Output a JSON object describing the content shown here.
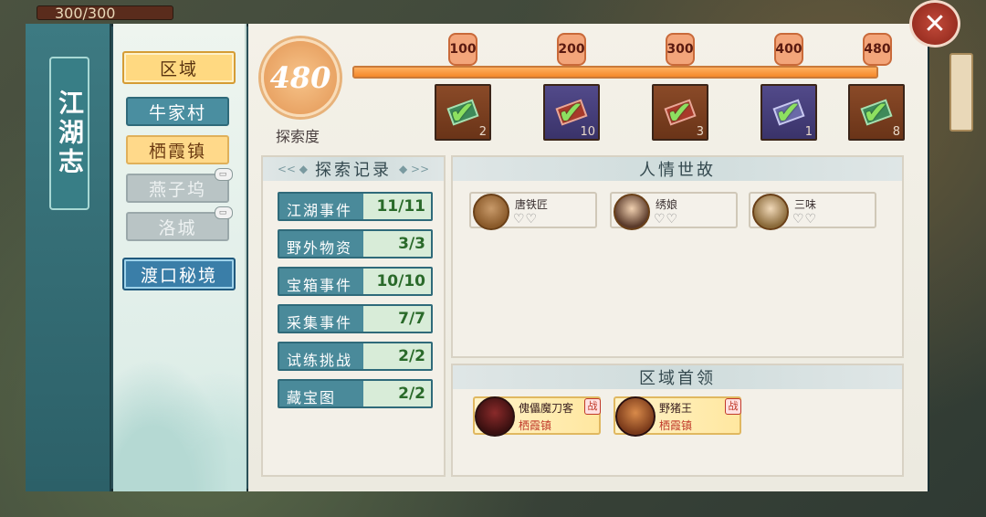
{
  "hud": {
    "hp": "300/300"
  },
  "sidebar_title": "江湖志",
  "nav": {
    "header": "区域",
    "items": [
      {
        "label": "牛家村"
      },
      {
        "label": "栖霞镇"
      },
      {
        "label": "燕子坞"
      },
      {
        "label": "洛城"
      }
    ],
    "secret": "渡口秘境"
  },
  "exploration": {
    "score": "480",
    "label": "探索度",
    "progress": 1.0,
    "milestones": [
      "100",
      "200",
      "300",
      "400",
      "480"
    ],
    "rewards": [
      {
        "count": "2",
        "tier": "brown"
      },
      {
        "count": "10",
        "tier": "purple"
      },
      {
        "count": "3",
        "tier": "brown"
      },
      {
        "count": "1",
        "tier": "purple"
      },
      {
        "count": "8",
        "tier": "brown"
      }
    ]
  },
  "records": {
    "title": "探索记录",
    "items": [
      {
        "label": "江湖事件",
        "value": "11/11"
      },
      {
        "label": "野外物资",
        "value": "3/3"
      },
      {
        "label": "宝箱事件",
        "value": "10/10"
      },
      {
        "label": "采集事件",
        "value": "7/7"
      },
      {
        "label": "试练挑战",
        "value": "2/2"
      },
      {
        "label": "藏宝图",
        "value": "2/2"
      }
    ]
  },
  "relations": {
    "title": "人情世故",
    "npcs": [
      {
        "name": "唐铁匠",
        "hearts": "♡♡"
      },
      {
        "name": "绣娘",
        "hearts": "♡♡"
      },
      {
        "name": "三味",
        "hearts": "♡♡"
      }
    ]
  },
  "bosses": {
    "title": "区域首领",
    "items": [
      {
        "name": "傀儡魔刀客",
        "place": "栖霞镇",
        "badge": "战"
      },
      {
        "name": "野猪王",
        "place": "栖霞镇",
        "badge": "战"
      }
    ]
  },
  "close_icon": "close-icon",
  "deco": {
    "left": "<<  ◆",
    "right": "◆  >>"
  }
}
